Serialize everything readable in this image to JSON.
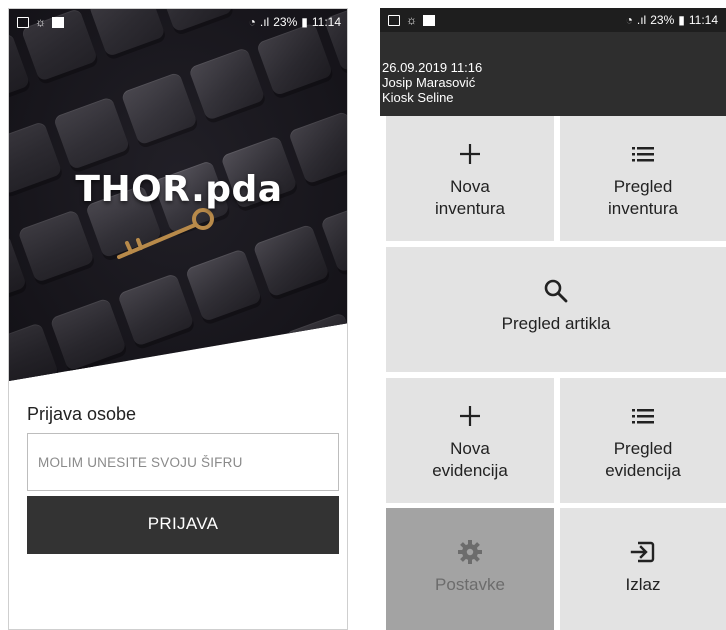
{
  "login_screen": {
    "status_bar": {
      "battery": "23%",
      "time": "11:14"
    },
    "brand": "THOR.pda",
    "form_title": "Prijava osobe",
    "code_placeholder": "MOLIM UNESITE SVOJU ŠIFRU",
    "login_label": "PRIJAVA"
  },
  "menu_screen": {
    "status_bar": {
      "battery": "23%",
      "time": "11:14"
    },
    "datetime": "26.09.2019 11:16",
    "user": "Josip Marasović",
    "location": "Kiosk Seline",
    "tiles": {
      "new_inventory": {
        "label": "Nova\ninventura",
        "icon": "plus-icon"
      },
      "inventory_list": {
        "label": "Pregled\ninventura",
        "icon": "list-icon"
      },
      "article_search": {
        "label": "Pregled artikla",
        "icon": "search-icon"
      },
      "new_record": {
        "label": "Nova\nevidencija",
        "icon": "plus-icon"
      },
      "record_list": {
        "label": "Pregled\nevidencija",
        "icon": "list-icon"
      },
      "settings": {
        "label": "Postavke",
        "icon": "gear-icon",
        "state": "disabled"
      },
      "exit": {
        "label": "Izlaz",
        "icon": "exit-icon"
      }
    }
  },
  "colors": {
    "login_button": "#333333",
    "tile": "#e3e3e3",
    "tile_disabled": "#a3a3a3",
    "header": "#2e2e2e"
  }
}
